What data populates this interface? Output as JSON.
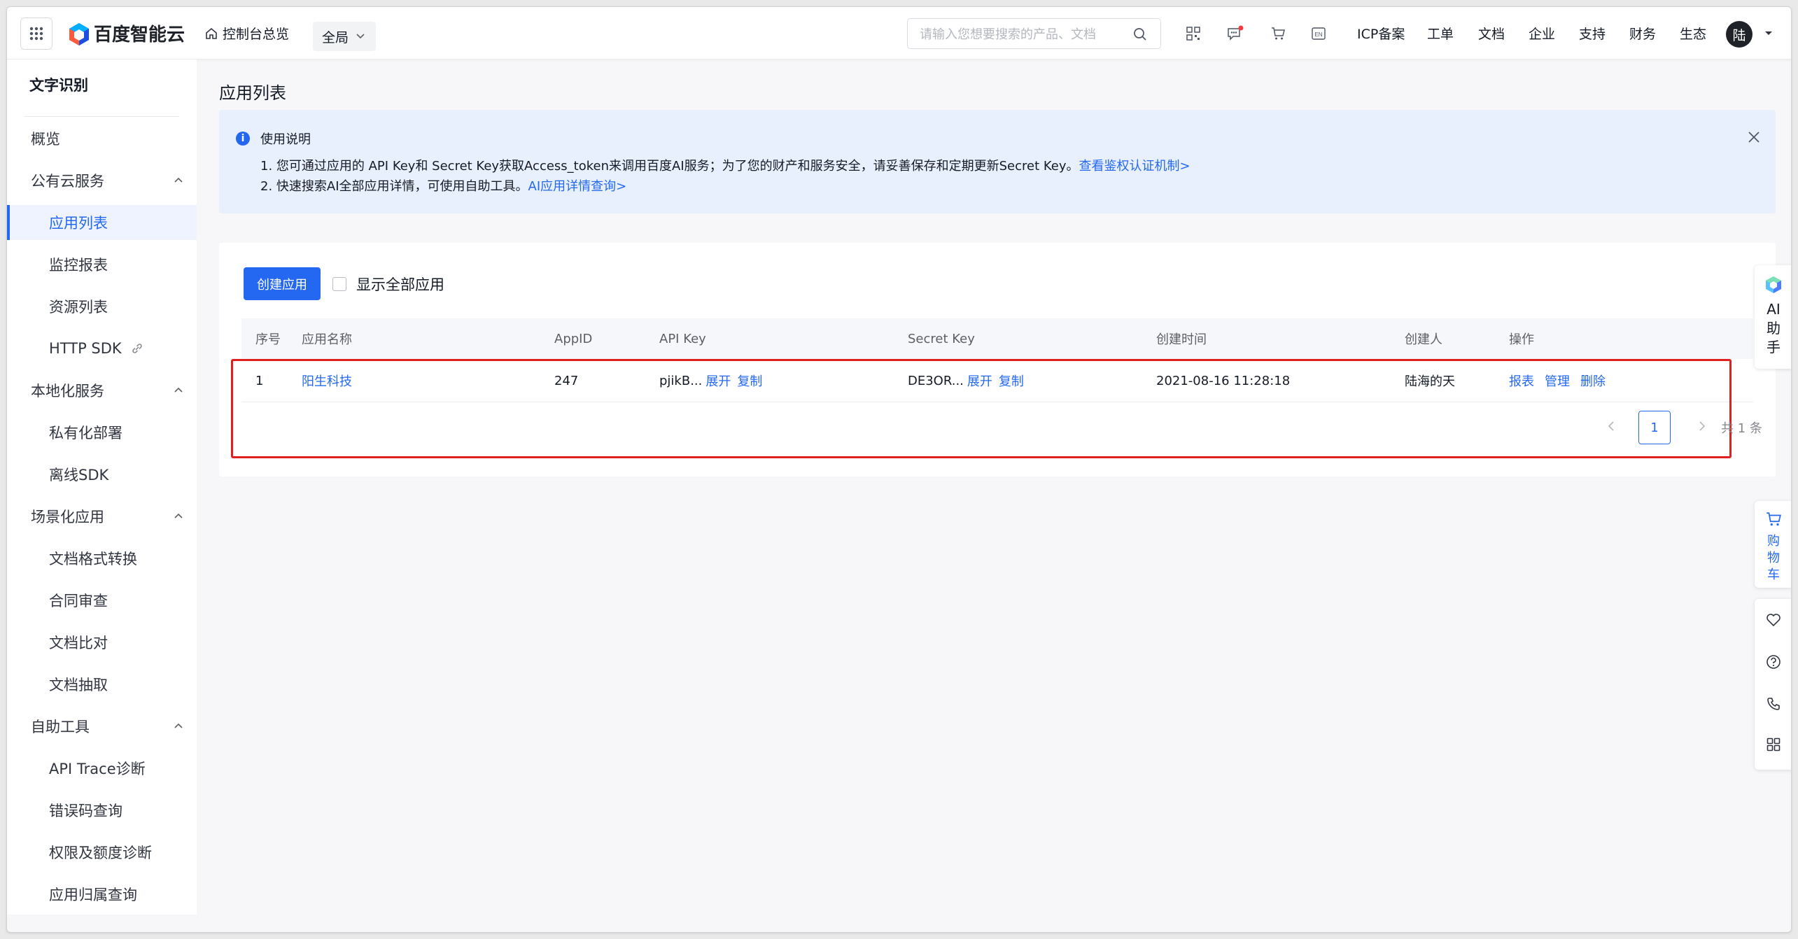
{
  "topbar": {
    "brand": "百度智能云",
    "console": "控制台总览",
    "scope": "全局",
    "search_placeholder": "请输入您想要搜索的产品、文档",
    "nav": [
      "ICP备案",
      "工单",
      "文档",
      "企业",
      "支持",
      "财务",
      "生态"
    ],
    "avatar": "陆"
  },
  "sidebar": {
    "title": "文字识别",
    "items": [
      {
        "label": "概览",
        "type": "group"
      },
      {
        "label": "公有云服务",
        "type": "group",
        "expanded": true
      },
      {
        "label": "应用列表",
        "type": "sub",
        "active": true
      },
      {
        "label": "监控报表",
        "type": "sub"
      },
      {
        "label": "资源列表",
        "type": "sub"
      },
      {
        "label": "HTTP SDK",
        "type": "sub",
        "icon": "link-icon"
      },
      {
        "label": "本地化服务",
        "type": "group",
        "expanded": true
      },
      {
        "label": "私有化部署",
        "type": "sub"
      },
      {
        "label": "离线SDK",
        "type": "sub"
      },
      {
        "label": "场景化应用",
        "type": "group",
        "expanded": true
      },
      {
        "label": "文档格式转换",
        "type": "sub"
      },
      {
        "label": "合同审查",
        "type": "sub"
      },
      {
        "label": "文档比对",
        "type": "sub"
      },
      {
        "label": "文档抽取",
        "type": "sub"
      },
      {
        "label": "自助工具",
        "type": "group",
        "expanded": true
      },
      {
        "label": "API Trace诊断",
        "type": "sub"
      },
      {
        "label": "错误码查询",
        "type": "sub"
      },
      {
        "label": "权限及额度诊断",
        "type": "sub"
      },
      {
        "label": "应用归属查询",
        "type": "sub"
      }
    ]
  },
  "main": {
    "title": "应用列表",
    "notice": {
      "title": "使用说明",
      "line1": "1. 您可通过应用的 API Key和 Secret Key获取Access_token来调用百度AI服务；为了您的财产和服务安全，请妥善保存和定期更新Secret Key。",
      "line1_link": "查看鉴权认证机制>",
      "line2": "2. 快速搜索AI全部应用详情，可使用自助工具。",
      "line2_link": "AI应用详情查询>"
    },
    "create_button": "创建应用",
    "show_all": "显示全部应用",
    "table": {
      "headers": [
        "序号",
        "应用名称",
        "AppID",
        "API Key",
        "Secret Key",
        "创建时间",
        "创建人",
        "操作"
      ],
      "rows": [
        {
          "index": "1",
          "name": "阳生科技",
          "appid": "247",
          "api_key": "pjikB...",
          "secret_key": "DE3OR...",
          "created": "2021-08-16 11:28:18",
          "creator": "陆海的天",
          "expand": "展开",
          "copy": "复制",
          "actions": [
            "报表",
            "管理",
            "删除"
          ]
        }
      ]
    },
    "pager": {
      "current": "1",
      "total": "共 1 条"
    }
  },
  "floating": {
    "ai_assistant": "AI助手",
    "cart": "购物车"
  },
  "colors": {
    "accent": "#2468f2",
    "highlight": "#e02020",
    "badge": "#f03e3e"
  }
}
